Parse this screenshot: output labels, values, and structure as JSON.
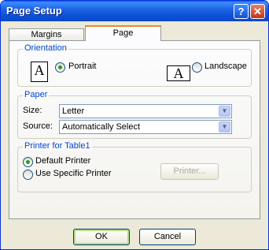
{
  "window": {
    "title": "Page Setup",
    "help_glyph": "?",
    "close_glyph": "✕"
  },
  "tabs": [
    {
      "label": "Margins",
      "active": false
    },
    {
      "label": "Page",
      "active": true
    }
  ],
  "orientation": {
    "group_label": "Orientation",
    "portrait_icon_text": "A",
    "landscape_icon_text": "A",
    "portrait_label": "Portrait",
    "landscape_label": "Landscape",
    "selected": "Portrait"
  },
  "paper": {
    "group_label": "Paper",
    "size_label": "Size:",
    "size_value": "Letter",
    "source_label": "Source:",
    "source_value": "Automatically Select",
    "dropdown_glyph": "▼"
  },
  "printer": {
    "group_label": "Printer for Table1",
    "default_label": "Default Printer",
    "specific_label": "Use Specific Printer",
    "selected": "Default Printer",
    "printer_button_label": "Printer..."
  },
  "buttons": {
    "ok": "OK",
    "cancel": "Cancel"
  }
}
